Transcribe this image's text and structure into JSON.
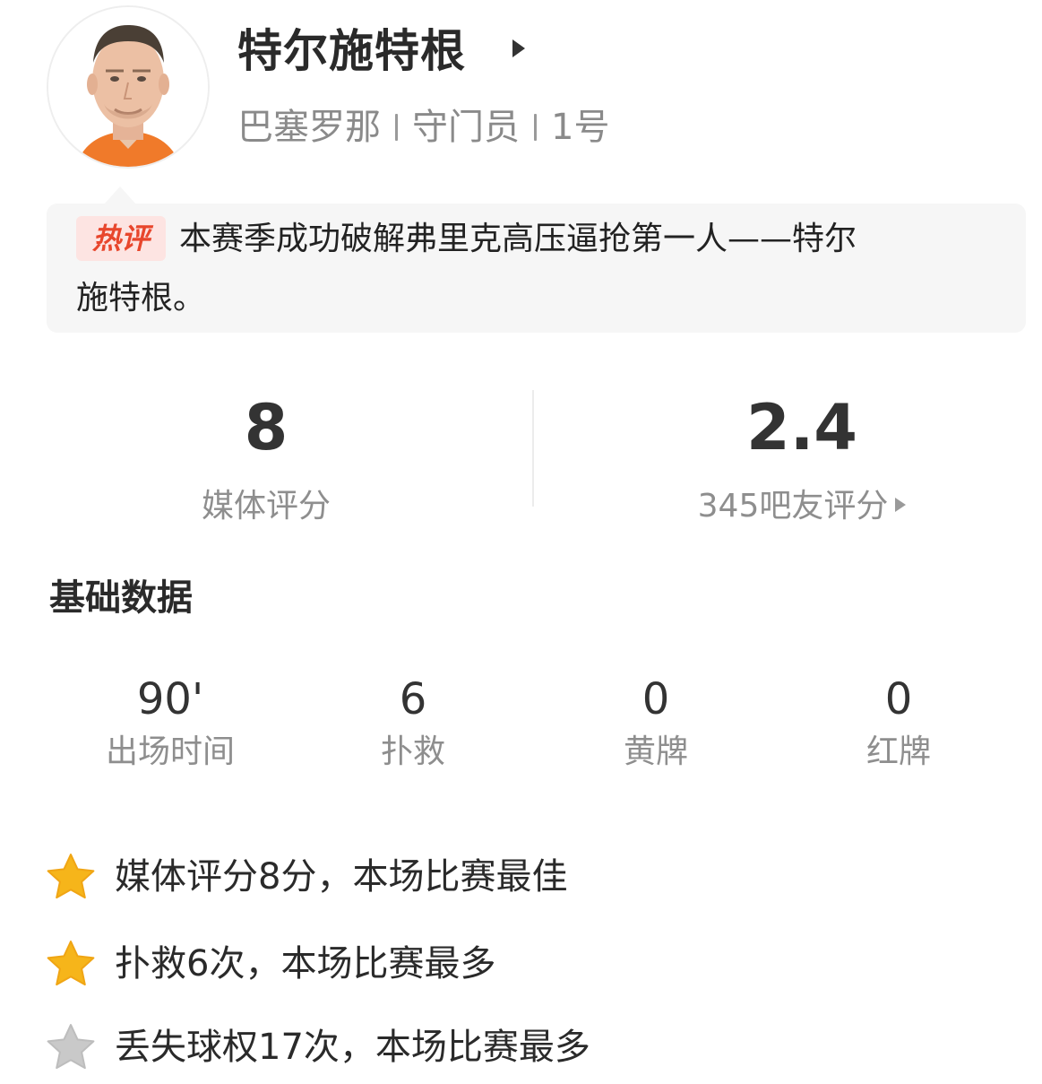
{
  "player": {
    "name": "特尔施特根",
    "club": "巴塞罗那",
    "position": "守门员",
    "number": "1号"
  },
  "hot_comment": {
    "badge": "热评",
    "line1": "本赛季成功破解弗里克高压逼抢第一人——特尔",
    "line2": "施特根。"
  },
  "ratings": {
    "media": {
      "value": "8",
      "label": "媒体评分"
    },
    "fans": {
      "value": "2.4",
      "label": "345吧友评分"
    }
  },
  "basic_stats": {
    "title": "基础数据",
    "items": [
      {
        "value": "90'",
        "label": "出场时间"
      },
      {
        "value": "6",
        "label": "扑救"
      },
      {
        "value": "0",
        "label": "黄牌"
      },
      {
        "value": "0",
        "label": "红牌"
      }
    ]
  },
  "highlights": [
    {
      "text": "媒体评分8分，本场比赛最佳",
      "icon": "star-gold-icon"
    },
    {
      "text": "扑救6次，本场比赛最多",
      "icon": "star-gold-icon"
    },
    {
      "text": "丢失球权17次，本场比赛最多",
      "icon": "star-gray-icon"
    }
  ],
  "colors": {
    "hot_badge_text": "#e8462c",
    "hot_badge_bg": "#fde4e2",
    "star_gold": "#f6b51a",
    "star_gray": "#c9c9c9",
    "comment_bg": "#f6f6f6"
  }
}
